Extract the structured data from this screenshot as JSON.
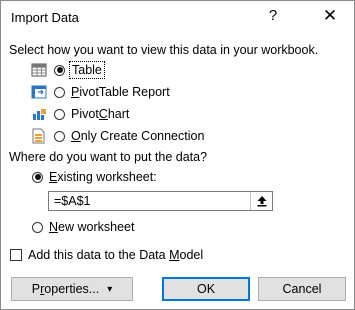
{
  "dialog": {
    "title": "Import Data",
    "help_glyph": "?",
    "close_glyph": "✕"
  },
  "view_section": {
    "prompt": "Select how you want to view this data in your workbook.",
    "options": [
      {
        "label": "Table",
        "selected": true,
        "icon": "table-icon"
      },
      {
        "label": "PivotTable Report",
        "selected": false,
        "icon": "pivottable-icon"
      },
      {
        "label": "PivotChart",
        "selected": false,
        "icon": "pivotchart-icon"
      },
      {
        "label": "Only Create Connection",
        "selected": false,
        "icon": "connection-icon"
      }
    ]
  },
  "location_section": {
    "prompt": "Where do you want to put the data?",
    "existing_label": "Existing worksheet:",
    "existing_selected": true,
    "range_value": "=$A$1",
    "new_label": "New worksheet",
    "new_selected": false
  },
  "data_model": {
    "label": "Add this data to the Data Model",
    "checked": false
  },
  "buttons": {
    "properties_label": "Properties...",
    "properties_caret": "▾",
    "ok_label": "OK",
    "cancel_label": "Cancel"
  },
  "colors": {
    "focus_border": "#0078d7",
    "button_face": "#e1e1e1",
    "icon_blue": "#2b74c9",
    "icon_orange": "#e8a33a"
  }
}
